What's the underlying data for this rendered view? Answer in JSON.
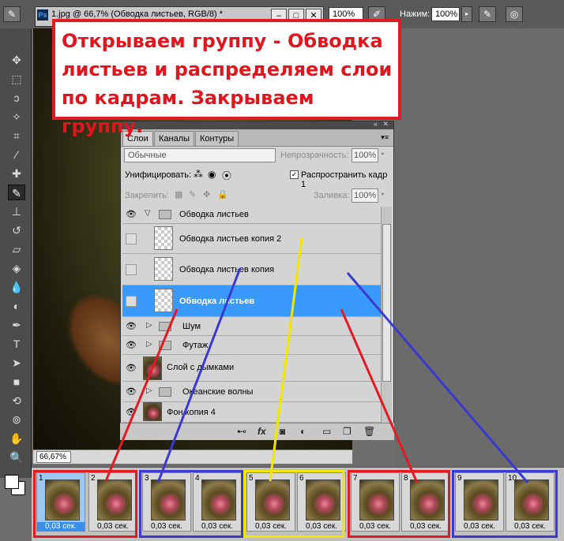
{
  "app": {
    "doc_title": "1.jpg @ 66,7% (Обводка листьев, RGB/8) *",
    "ps_badge": "Ps",
    "zoom_top": "100%",
    "pressure_label": "Нажим:",
    "pressure_value": "100%",
    "zoom_status": "66,67%"
  },
  "annotation": {
    "text": "Открываем группу - Обводка листьев и распределяем слои по кадрам. Закрываем группу.",
    "color": "#e0151d"
  },
  "layers_panel": {
    "tabs": [
      "Слои",
      "Каналы",
      "Контуры"
    ],
    "blend_mode": "Обычные",
    "opacity_label": "Непрозрачность:",
    "opacity_value": "100%",
    "unify_label": "Унифицировать:",
    "propagate_label": "Распространить кадр 1",
    "lock_label": "Закрепить:",
    "fill_label": "Заливка:",
    "fill_value": "100%",
    "layers": [
      {
        "name": "Обводка листьев",
        "kind": "group-open"
      },
      {
        "name": "Обводка листьев копия 2",
        "kind": "layer"
      },
      {
        "name": "Обводка листьев копия",
        "kind": "layer"
      },
      {
        "name": "Обводка листьев",
        "kind": "layer-selected"
      },
      {
        "name": "Шум",
        "kind": "group"
      },
      {
        "name": "Футаж",
        "kind": "group"
      },
      {
        "name": "Слой с дымками",
        "kind": "photo"
      },
      {
        "name": "Океанские волны",
        "kind": "group"
      },
      {
        "name": "Фон копия 4",
        "kind": "photo"
      }
    ],
    "footer_icons": [
      "link-icon",
      "fx-icon",
      "mask-icon",
      "adjustment-icon",
      "group-icon",
      "new-layer-icon",
      "trash-icon"
    ]
  },
  "animation": {
    "frames": [
      {
        "num": "1",
        "dur": "0,03 сек."
      },
      {
        "num": "2",
        "dur": "0,03 сек."
      },
      {
        "num": "3",
        "dur": "0,03 сек."
      },
      {
        "num": "4",
        "dur": "0,03 сек."
      },
      {
        "num": "5",
        "dur": "0,03 сек."
      },
      {
        "num": "6",
        "dur": "0,03 сек."
      },
      {
        "num": "7",
        "dur": "0,03 сек."
      },
      {
        "num": "8",
        "dur": "0,03 сек."
      },
      {
        "num": "9",
        "dur": "0,03 сек."
      },
      {
        "num": "10",
        "dur": "0,03 сек."
      }
    ],
    "group_colors": [
      "#e21b22",
      "#3a3ad0",
      "#f2e600",
      "#e21b22",
      "#3a3ad0"
    ]
  },
  "arrow_colors": {
    "red": "#e21b22",
    "blue": "#3a3ad0",
    "yellow": "#f2e600"
  }
}
